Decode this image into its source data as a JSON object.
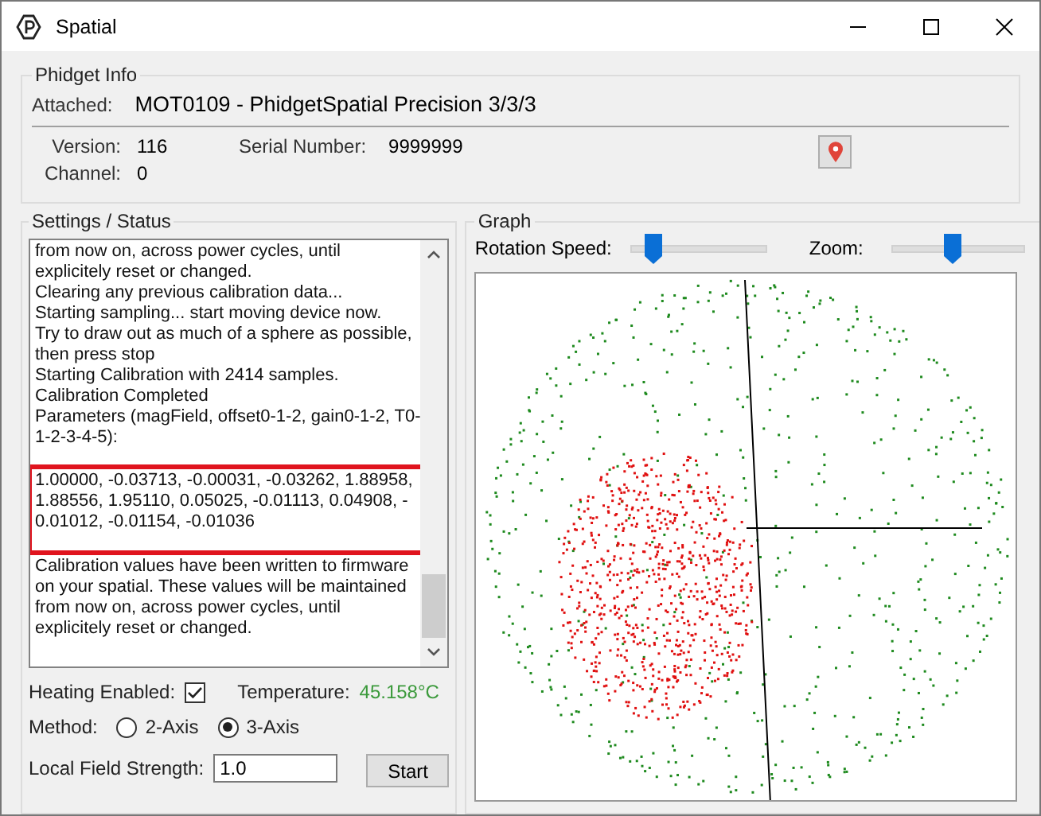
{
  "window": {
    "title": "Spatial"
  },
  "phidget_info": {
    "title": "Phidget Info",
    "attached_label": "Attached:",
    "attached_value": "MOT0109 - PhidgetSpatial Precision 3/3/3",
    "version_label": "Version:",
    "version_value": "116",
    "serial_label": "Serial Number:",
    "serial_value": "9999999",
    "channel_label": "Channel:",
    "channel_value": "0"
  },
  "settings": {
    "title": "Settings / Status",
    "log_blocks": [
      {
        "highlighted": false,
        "lines": [
          "from now on, across power cycles, until",
          "explicitely reset or changed.",
          "Clearing any previous calibration data...",
          "Starting sampling... start moving device now.",
          "Try to draw out as much of a sphere as possible,",
          "then press stop",
          "Starting Calibration with 2414 samples.",
          "Calibration Completed",
          "Parameters (magField, offset0-1-2, gain0-1-2, T0-",
          "1-2-3-4-5):"
        ]
      },
      {
        "highlighted": true,
        "lines": [
          "1.00000, -0.03713, -0.00031, -0.03262, 1.88958,",
          "1.88556, 1.95110, 0.05025, -0.01113, 0.04908, -",
          "0.01012, -0.01154, -0.01036"
        ]
      },
      {
        "highlighted": false,
        "lines": [
          "Calibration values have been written to firmware",
          "on your spatial. These values will be maintained",
          "from now on, across power cycles, until",
          "explicitely reset or changed."
        ]
      }
    ],
    "heating_label": "Heating Enabled:",
    "heating_checked": true,
    "temperature_label": "Temperature:",
    "temperature_value": "45.158°C",
    "method_label": "Method:",
    "methods": [
      {
        "label": "2-Axis",
        "selected": false
      },
      {
        "label": "3-Axis",
        "selected": true
      }
    ],
    "field_strength_label": "Local Field Strength:",
    "field_strength_value": "1.0",
    "start_button": "Start"
  },
  "graph": {
    "title": "Graph",
    "rotation_speed": {
      "label": "Rotation Speed:",
      "level": 0.15
    },
    "zoom": {
      "label": "Zoom:",
      "level": 0.4
    }
  }
}
